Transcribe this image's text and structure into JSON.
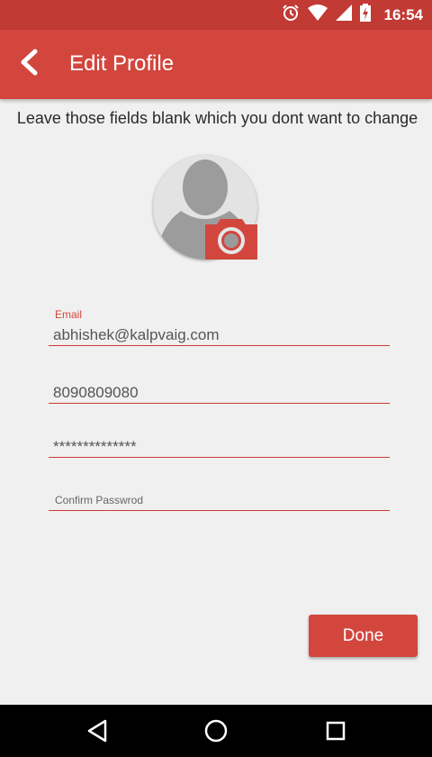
{
  "status_bar": {
    "time": "16:54",
    "icons": [
      "alarm-icon",
      "wifi-icon",
      "signal-icon",
      "battery-charging-icon"
    ]
  },
  "app_bar": {
    "title": "Edit Profile",
    "back_icon": "chevron-left-icon"
  },
  "hint": "Leave those fields blank which you dont want to change",
  "profile": {
    "avatar_icon": "default-avatar-icon",
    "camera_icon": "camera-icon"
  },
  "form": {
    "email": {
      "label": "Email",
      "value": "abhishek@kalpvaig.com"
    },
    "phone": {
      "value": "8090809080"
    },
    "password": {
      "value": "**************"
    },
    "confirm_password": {
      "placeholder": "Confirm Passwrod"
    }
  },
  "done_label": "Done",
  "nav": {
    "icons": [
      "back-triangle-icon",
      "home-circle-icon",
      "recents-square-icon"
    ]
  },
  "colors": {
    "primary": "#d2463e",
    "status_bar": "#c23a34",
    "background": "#f0f0f0",
    "underline": "#d13a34"
  }
}
